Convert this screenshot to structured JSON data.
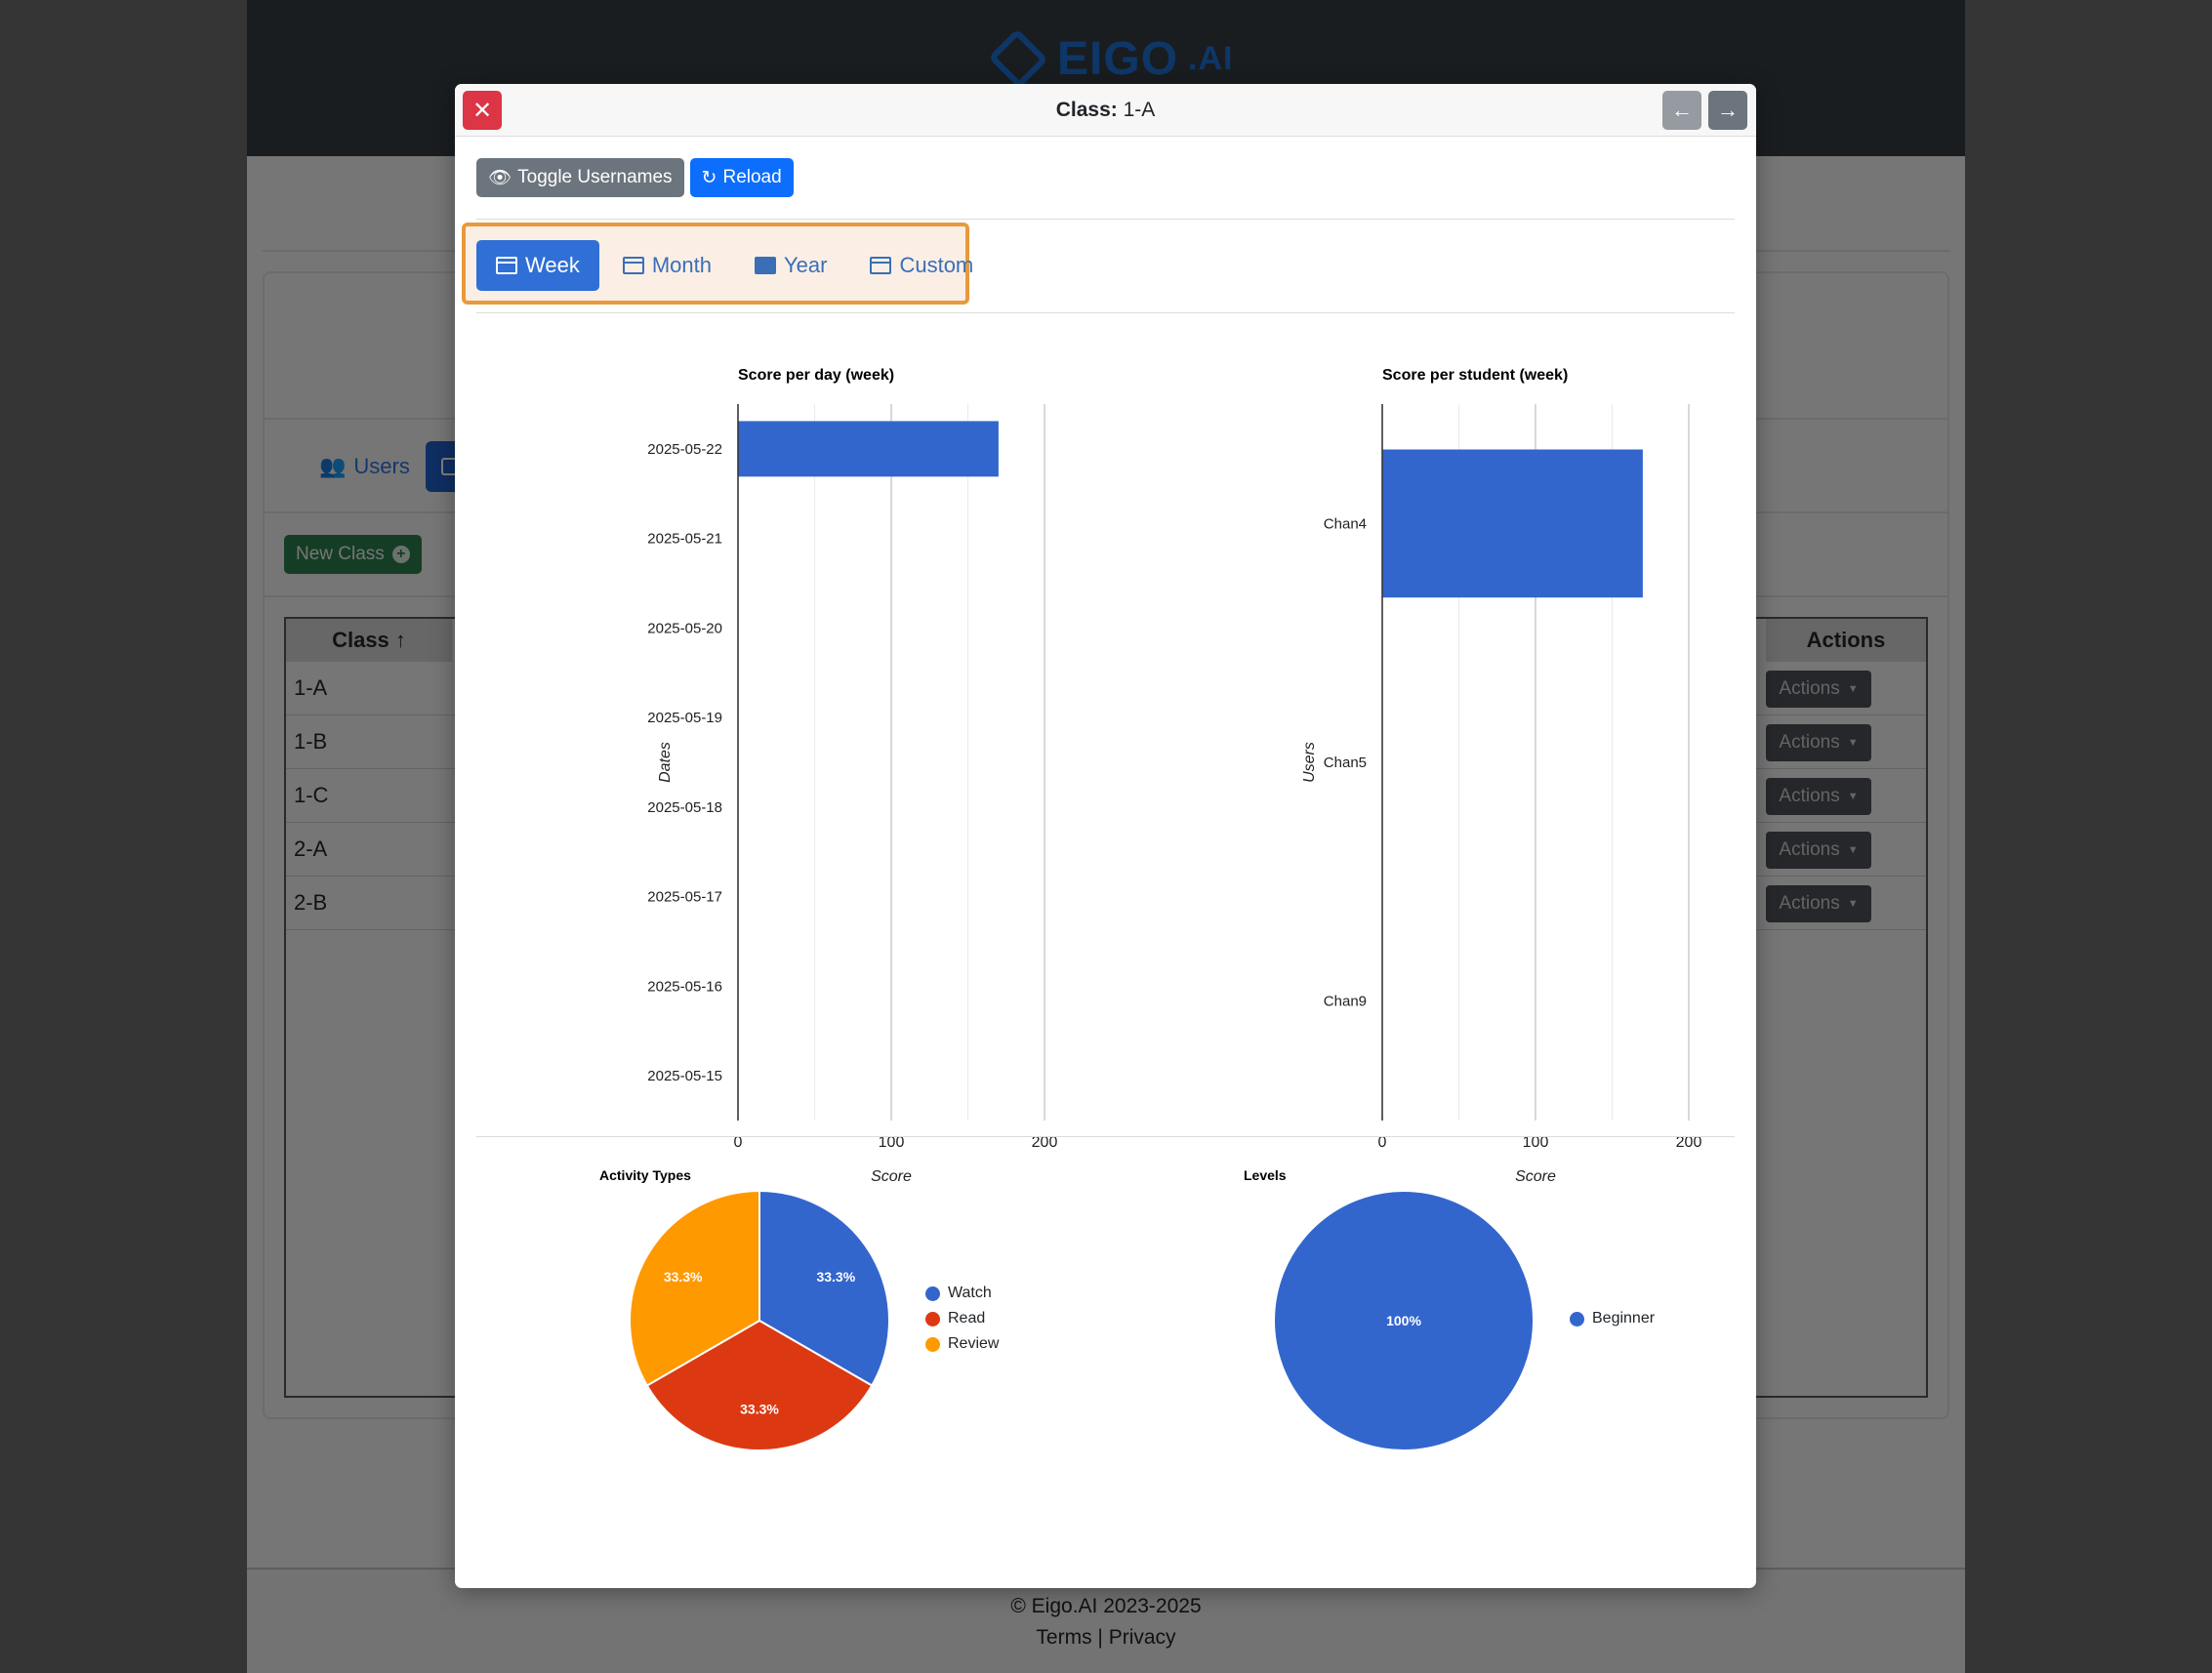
{
  "background": {
    "logo_text": "EIGO",
    "logo_suffix": ".AI",
    "tabs": [
      {
        "label": "Users",
        "icon": "users-icon"
      }
    ],
    "new_class_label": "New Class",
    "table": {
      "header_class": "Class ↑",
      "header_actions": "Actions",
      "rows": [
        {
          "class": "1-A",
          "action": "Actions"
        },
        {
          "class": "1-B",
          "action": "Actions"
        },
        {
          "class": "1-C",
          "action": "Actions"
        },
        {
          "class": "2-A",
          "action": "Actions"
        },
        {
          "class": "2-B",
          "action": "Actions"
        }
      ]
    },
    "footer": {
      "copyright": "© Eigo.AI 2023-2025",
      "links": "Terms | Privacy"
    }
  },
  "modal": {
    "title_label": "Class:",
    "title_value": "1-A",
    "toolbar": {
      "toggle_usernames": "Toggle Usernames",
      "reload": "Reload"
    },
    "period_tabs": [
      {
        "label": "Week",
        "active": true
      },
      {
        "label": "Month",
        "active": false
      },
      {
        "label": "Year",
        "active": false
      },
      {
        "label": "Custom",
        "active": false
      }
    ]
  },
  "colors": {
    "primary": "#3366cc",
    "red": "#dc3912",
    "orange": "#ff9900",
    "accent_border": "#e89a3c"
  },
  "chart_data": [
    {
      "type": "bar",
      "orientation": "horizontal",
      "title": "Score per day (week)",
      "xlabel": "Score",
      "ylabel": "Dates",
      "categories": [
        "2025-05-22",
        "2025-05-21",
        "2025-05-20",
        "2025-05-19",
        "2025-05-18",
        "2025-05-17",
        "2025-05-16",
        "2025-05-15"
      ],
      "values": [
        170,
        0,
        0,
        0,
        0,
        0,
        0,
        0
      ],
      "xlim": [
        0,
        200
      ],
      "xticks": [
        0,
        100,
        200
      ],
      "grid": true
    },
    {
      "type": "bar",
      "orientation": "horizontal",
      "title": "Score per student (week)",
      "xlabel": "Score",
      "ylabel": "Users",
      "categories": [
        "Chan4",
        "Chan5",
        "Chan9"
      ],
      "values": [
        170,
        0,
        0
      ],
      "xlim": [
        0,
        200
      ],
      "xticks": [
        0,
        100,
        200
      ],
      "grid": true
    },
    {
      "type": "pie",
      "title": "Activity Types",
      "labels": [
        "Watch",
        "Read",
        "Review"
      ],
      "values": [
        33.3,
        33.3,
        33.3
      ],
      "slice_labels": [
        "33.3%",
        "33.3%",
        "33.3%"
      ],
      "colors": [
        "#3366cc",
        "#dc3912",
        "#ff9900"
      ],
      "legend": "right"
    },
    {
      "type": "pie",
      "title": "Levels",
      "labels": [
        "Beginner"
      ],
      "values": [
        100
      ],
      "slice_labels": [
        "100%"
      ],
      "colors": [
        "#3366cc"
      ],
      "legend": "right"
    }
  ]
}
